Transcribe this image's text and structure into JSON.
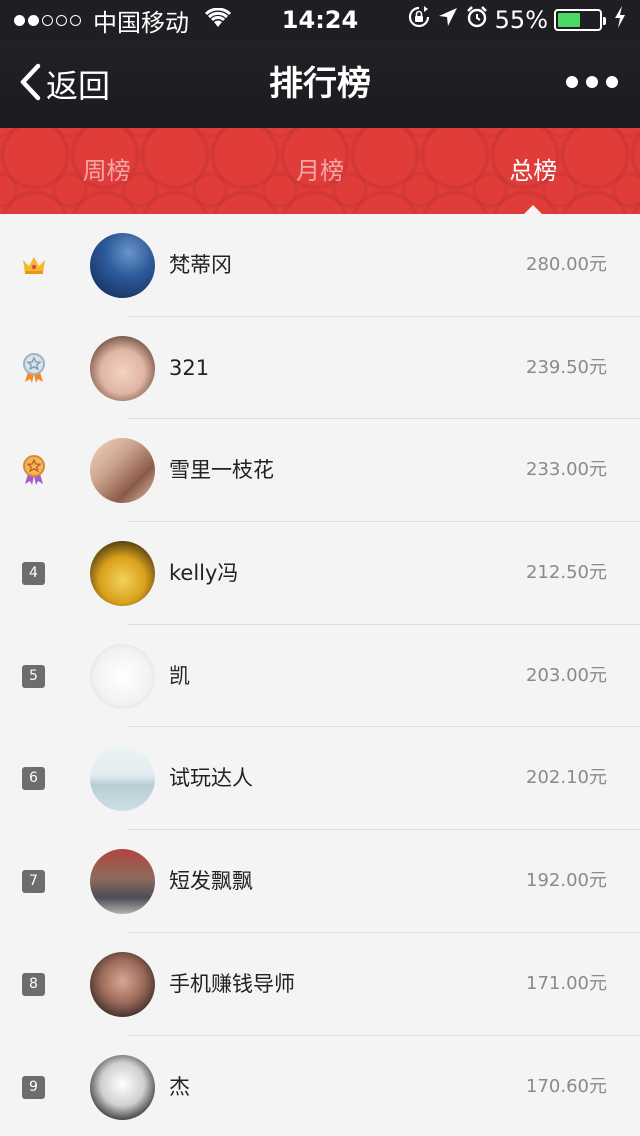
{
  "status_bar": {
    "carrier": "中国移动",
    "time": "14:24",
    "battery_percent": "55%",
    "battery_level": 0.55,
    "signal_bars": 2
  },
  "nav": {
    "back_label": "返回",
    "title": "排行榜"
  },
  "tabs": [
    {
      "label": "周榜",
      "active": false
    },
    {
      "label": "月榜",
      "active": false
    },
    {
      "label": "总榜",
      "active": true
    }
  ],
  "ranking": [
    {
      "rank": "1",
      "badge": "crown-icon",
      "name": "梵蒂冈",
      "amount": "280.00元",
      "avatar": "night-sky"
    },
    {
      "rank": "2",
      "badge": "silver-medal-icon",
      "name": "321",
      "amount": "239.50元",
      "avatar": "face"
    },
    {
      "rank": "3",
      "badge": "bronze-medal-icon",
      "name": "雪里一枝花",
      "amount": "233.00元",
      "avatar": "arch"
    },
    {
      "rank": "4",
      "badge": "",
      "name": "kelly冯",
      "amount": "212.50元",
      "avatar": "cup"
    },
    {
      "rank": "5",
      "badge": "",
      "name": "凯",
      "amount": "203.00元",
      "avatar": "cartoon"
    },
    {
      "rank": "6",
      "badge": "",
      "name": "试玩达人",
      "amount": "202.10元",
      "avatar": "mountain"
    },
    {
      "rank": "7",
      "badge": "",
      "name": "短发飘飘",
      "amount": "192.00元",
      "avatar": "street"
    },
    {
      "rank": "8",
      "badge": "",
      "name": "手机赚钱导师",
      "amount": "171.00元",
      "avatar": "portrait"
    },
    {
      "rank": "9",
      "badge": "",
      "name": "杰",
      "amount": "170.60元",
      "avatar": "sketch"
    }
  ],
  "colors": {
    "tab_bar": "#e03c3a",
    "nav_bar": "#1f1e22",
    "rank_badge": "#6d6d6d",
    "battery": "#4cd964"
  }
}
